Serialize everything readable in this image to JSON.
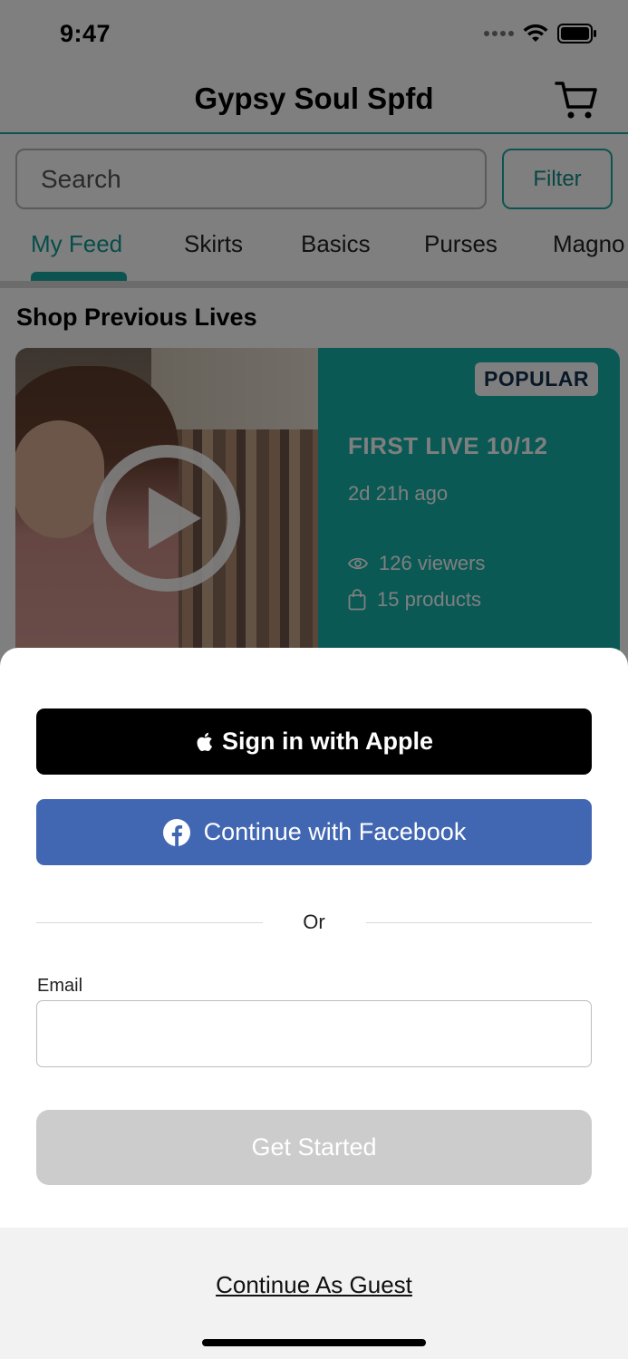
{
  "status_bar": {
    "time": "9:47"
  },
  "nav": {
    "title": "Gypsy Soul Spfd"
  },
  "search": {
    "placeholder": "Search",
    "filter_label": "Filter"
  },
  "tabs": [
    {
      "label": "My Feed",
      "active": true
    },
    {
      "label": "Skirts",
      "active": false
    },
    {
      "label": "Basics",
      "active": false
    },
    {
      "label": "Purses",
      "active": false
    },
    {
      "label": "Magno",
      "active": false
    }
  ],
  "section": {
    "title": "Shop Previous Lives"
  },
  "live_card": {
    "badge": "POPULAR",
    "title": "FIRST LIVE 10/12",
    "time_ago": "2d 21h ago",
    "viewers": "126 viewers",
    "products": "15 products"
  },
  "sheet": {
    "apple_label": "Sign in with Apple",
    "facebook_label": "Continue with Facebook",
    "or_label": "Or",
    "email_label": "Email",
    "email_value": "",
    "start_label": "Get Started",
    "guest_label": "Continue As Guest"
  },
  "colors": {
    "accent": "#1aa8a3",
    "card": "#14b3ab",
    "facebook": "#4267b2",
    "apple": "#000000",
    "disabled": "#cccccc"
  },
  "icons": [
    "signal-icon",
    "wifi-icon",
    "battery-icon",
    "cart-icon",
    "play-icon",
    "eye-icon",
    "bag-icon",
    "apple-icon",
    "facebook-icon"
  ]
}
